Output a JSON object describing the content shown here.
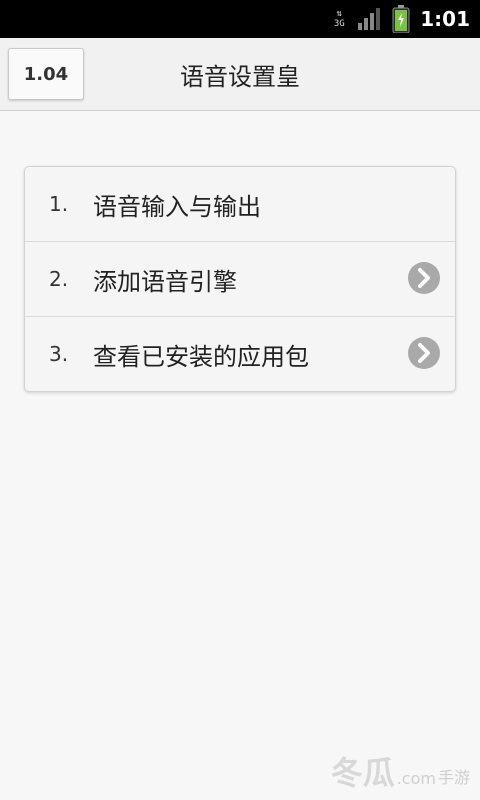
{
  "status_bar": {
    "network_top": "⇅",
    "network_label": "3G",
    "time": "1:01",
    "battery_color": "#7cc242"
  },
  "header": {
    "version_label": "1.04",
    "title": "语音设置皇"
  },
  "menu": {
    "items": [
      {
        "number": "1.",
        "label": "语音输入与输出",
        "has_chevron": false
      },
      {
        "number": "2.",
        "label": "添加语音引擎",
        "has_chevron": true
      },
      {
        "number": "3.",
        "label": "查看已安装的应用包",
        "has_chevron": true
      }
    ]
  },
  "watermark": {
    "mark": "冬瓜",
    "domain": ".com",
    "tag": "手游"
  },
  "icons": {
    "chevron": "chevron-right-icon",
    "signal": "signal-icon",
    "battery": "battery-icon"
  },
  "colors": {
    "status_bar_bg": "#000000",
    "page_bg": "#f7f7f7",
    "chevron_bg": "#a9a9a9"
  }
}
